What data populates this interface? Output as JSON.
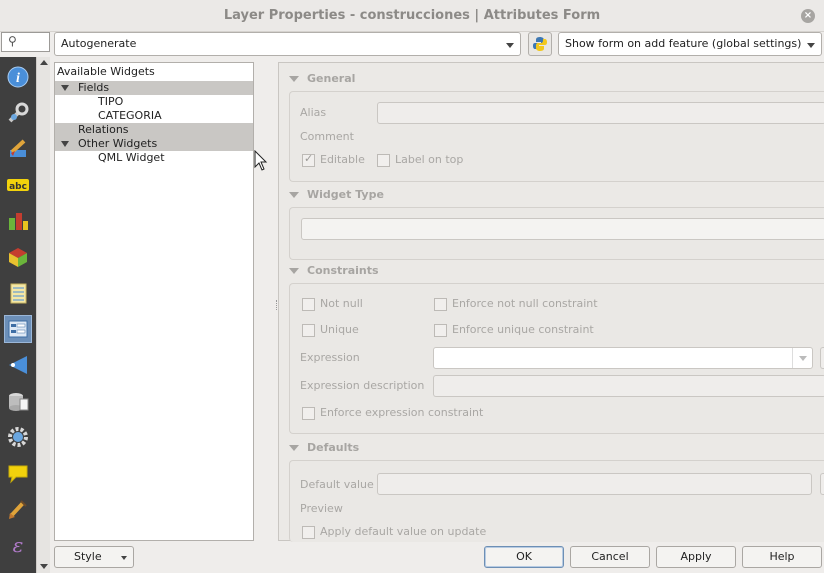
{
  "window": {
    "title": "Layer Properties - construcciones | Attributes Form"
  },
  "search": {
    "placeholder": ""
  },
  "sidebar": {
    "icons": [
      {
        "name": "information-icon",
        "color": "#4a8fd9"
      },
      {
        "name": "source-settings-icon",
        "color": "#c8c8c8"
      },
      {
        "name": "symbology-brush-icon",
        "color": "#e0a43a"
      },
      {
        "name": "labels-abc-icon",
        "color": "#f2d20c"
      },
      {
        "name": "diagrams-icon",
        "color": "#6bb53b"
      },
      {
        "name": "3d-view-icon",
        "color": "#e7c12f"
      },
      {
        "name": "fields-table-icon",
        "color": "#e8d57a"
      },
      {
        "name": "attributes-form-icon",
        "color": "#5f8fc4"
      },
      {
        "name": "joins-icon",
        "color": "#4a8fd9"
      },
      {
        "name": "auxiliary-storage-icon",
        "color": "#d8d8d8"
      },
      {
        "name": "actions-gear-icon",
        "color": "#6aa6df"
      },
      {
        "name": "display-tips-icon",
        "color": "#f2d20c"
      },
      {
        "name": "rendering-brush-icon",
        "color": "#e0a43a"
      },
      {
        "name": "variables-epsilon-icon",
        "color": "#b07ac9"
      }
    ]
  },
  "toolbar": {
    "layout_mode": "Autogenerate",
    "show_form_mode": "Show form on add feature (global settings)"
  },
  "tree": {
    "header": "Available Widgets",
    "fields_label": "Fields",
    "field_items": [
      "TIPO",
      "CATEGORIA"
    ],
    "relations_label": "Relations",
    "other_label": "Other Widgets",
    "other_items": [
      "QML Widget"
    ]
  },
  "general": {
    "title": "General",
    "alias_label": "Alias",
    "comment_label": "Comment",
    "editable_label": "Editable",
    "editable_checked": true,
    "label_on_top_label": "Label on top",
    "label_on_top_checked": false
  },
  "widget_type": {
    "title": "Widget Type",
    "value": ""
  },
  "constraints": {
    "title": "Constraints",
    "not_null_label": "Not null",
    "enforce_not_null_label": "Enforce not null constraint",
    "unique_label": "Unique",
    "enforce_unique_label": "Enforce unique constraint",
    "expression_label": "Expression",
    "expression_desc_label": "Expression description",
    "enforce_expression_label": "Enforce expression constraint"
  },
  "defaults": {
    "title": "Defaults",
    "default_value_label": "Default value",
    "preview_label": "Preview",
    "apply_on_update_label": "Apply default value on update"
  },
  "footer": {
    "style_label": "Style",
    "ok_label": "OK",
    "cancel_label": "Cancel",
    "apply_label": "Apply",
    "help_label": "Help"
  }
}
